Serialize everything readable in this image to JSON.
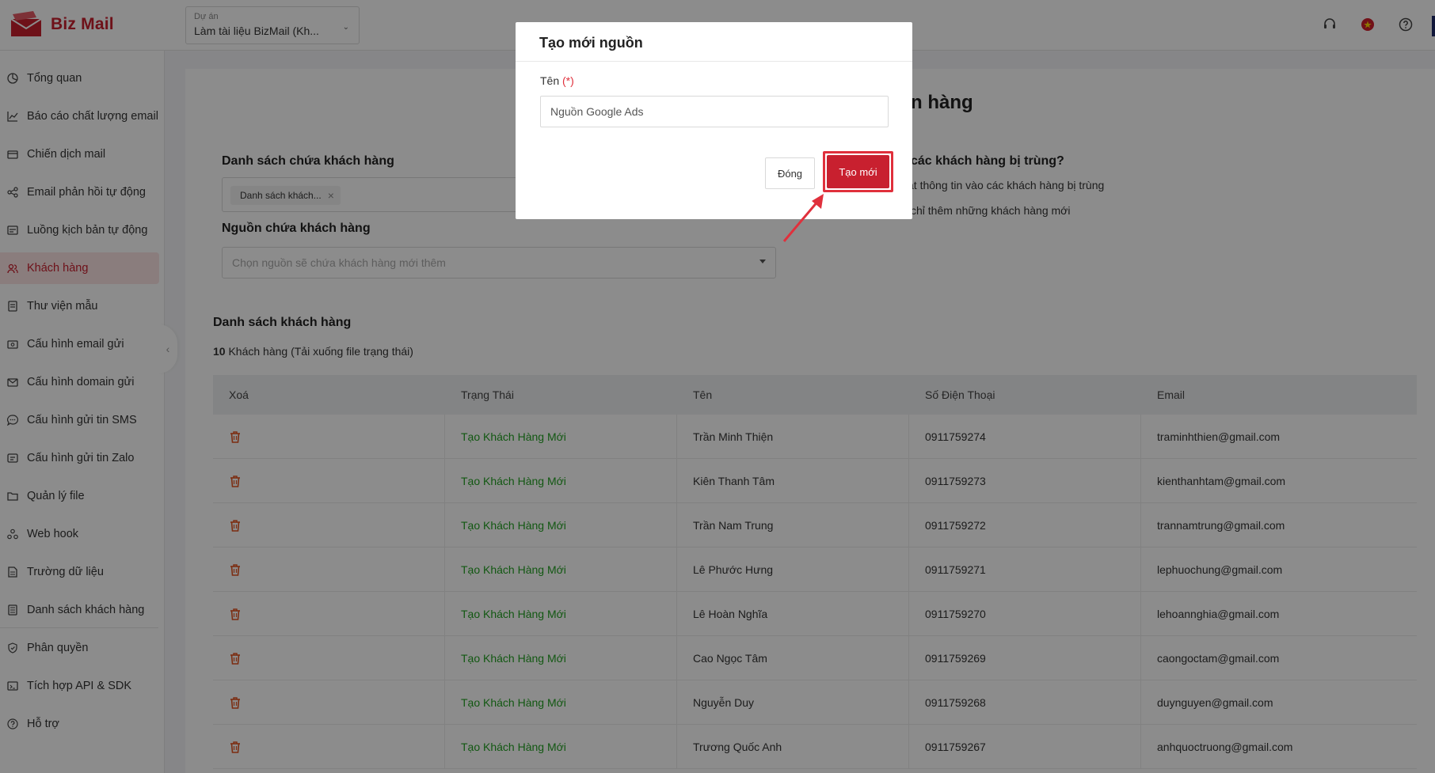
{
  "app": {
    "name": "Biz Mail",
    "brand_color": "#c8202f"
  },
  "project": {
    "label": "Dự án",
    "value": "Làm tài liệu BizMail (Kh..."
  },
  "top_icons": [
    "headset-icon",
    "vietnam-flag-icon",
    "help-icon"
  ],
  "sidebar": {
    "items": [
      {
        "label": "Tổng quan",
        "icon": "dashboard-icon"
      },
      {
        "label": "Báo cáo chất lượng email",
        "icon": "chart-icon"
      },
      {
        "label": "Chiến dịch mail",
        "icon": "campaign-icon"
      },
      {
        "label": "Email phản hồi tự động",
        "icon": "autoresponder-icon"
      },
      {
        "label": "Luồng kịch bản tự động",
        "icon": "workflow-icon"
      },
      {
        "label": "Khách hàng",
        "icon": "customers-icon",
        "active": true
      },
      {
        "label": "Thư viện mẫu",
        "icon": "template-icon"
      },
      {
        "label": "Cấu hình email gửi",
        "icon": "email-config-icon"
      },
      {
        "label": "Cấu hình domain gửi",
        "icon": "domain-icon"
      },
      {
        "label": "Cấu hình gửi tin SMS",
        "icon": "sms-icon"
      },
      {
        "label": "Cấu hình gửi tin Zalo",
        "icon": "zalo-icon"
      },
      {
        "label": "Quản lý file",
        "icon": "folder-icon"
      },
      {
        "label": "Web hook",
        "icon": "webhook-icon"
      },
      {
        "label": "Trường dữ liệu",
        "icon": "fields-icon"
      },
      {
        "label": "Danh sách khách hàng",
        "icon": "list-icon"
      },
      {
        "label": "Phân quyền",
        "icon": "permission-icon"
      },
      {
        "label": "Tích hợp API & SDK",
        "icon": "api-icon"
      },
      {
        "label": "Hỗ trợ",
        "icon": "support-icon"
      }
    ]
  },
  "page": {
    "title_partial": "n hàng",
    "list_section_label": "Danh sách chứa khách hàng",
    "list_tag": "Danh sách khách...",
    "source_section_label": "Nguồn chứa khách hàng",
    "source_placeholder": "Chọn nguồn sẽ chứa khách hàng mới thêm",
    "duplicate_question_partial": "các khách hàng bị trùng?",
    "duplicate_option_1_partial": "ật thông tin vào các khách hàng bị trùng",
    "duplicate_option_2_partial": "chỉ thêm những khách hàng mới",
    "customer_list_label": "Danh sách khách hàng",
    "count_number": "10",
    "count_text": " Khách hàng (Tải xuống file trạng thái)"
  },
  "table": {
    "headers": [
      "Xoá",
      "Trạng Thái",
      "Tên",
      "Số Điện Thoại",
      "Email"
    ],
    "status_color": "#22a022",
    "rows": [
      {
        "status": "Tạo Khách Hàng Mới",
        "name": "Trần Minh Thiện",
        "phone": "0911759274",
        "email": "traminhthien@gmail.com"
      },
      {
        "status": "Tạo Khách Hàng Mới",
        "name": "Kiên Thanh Tâm",
        "phone": "0911759273",
        "email": "kienthanhtam@gmail.com"
      },
      {
        "status": "Tạo Khách Hàng Mới",
        "name": "Trần Nam Trung",
        "phone": "0911759272",
        "email": "trannamtrung@gmail.com"
      },
      {
        "status": "Tạo Khách Hàng Mới",
        "name": "Lê Phước Hưng",
        "phone": "0911759271",
        "email": "lephuochung@gmail.com"
      },
      {
        "status": "Tạo Khách Hàng Mới",
        "name": "Lê Hoàn Nghĩa",
        "phone": "0911759270",
        "email": "lehoannghia@gmail.com"
      },
      {
        "status": "Tạo Khách Hàng Mới",
        "name": "Cao Ngọc Tâm",
        "phone": "0911759269",
        "email": "caongoctam@gmail.com"
      },
      {
        "status": "Tạo Khách Hàng Mới",
        "name": "Nguyễn Duy",
        "phone": "0911759268",
        "email": "duynguyen@gmail.com"
      },
      {
        "status": "Tạo Khách Hàng Mới",
        "name": "Trương Quốc Anh",
        "phone": "0911759267",
        "email": "anhquoctruong@gmail.com"
      }
    ]
  },
  "modal": {
    "title": "Tạo mới nguồn",
    "field_label": "Tên",
    "required_mark": "(*)",
    "field_value": "Nguồn Google Ads",
    "close_label": "Đóng",
    "create_label": "Tạo mới",
    "highlight_color": "#e0303c"
  }
}
